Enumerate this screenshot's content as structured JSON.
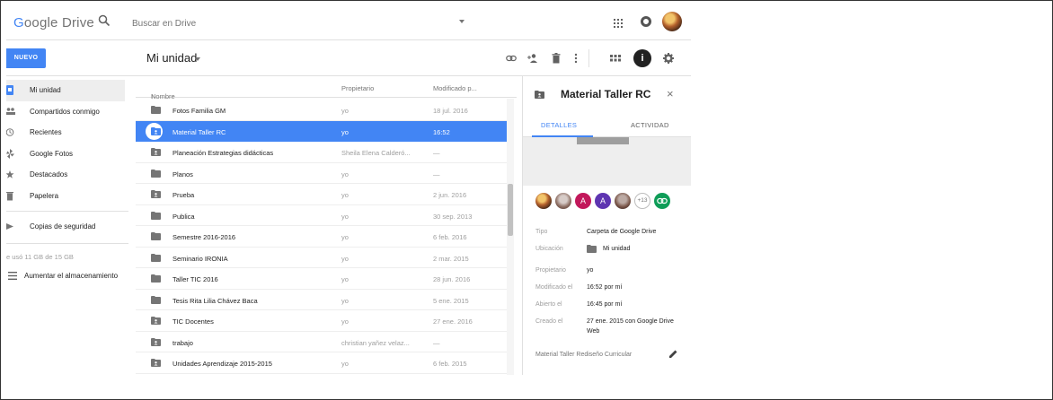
{
  "app": {
    "logo_text_1": "G",
    "logo_text_2": "oogle Drive",
    "search_placeholder": "Buscar en Drive"
  },
  "toolbar": {
    "new_button": "NUEVO",
    "breadcrumb": "Mi unidad"
  },
  "sidebar": {
    "items": [
      {
        "label": "Mi unidad",
        "icon": "drive-icon",
        "active": true
      },
      {
        "label": "Compartidos conmigo",
        "icon": "people-icon"
      },
      {
        "label": "Recientes",
        "icon": "clock-icon"
      },
      {
        "label": "Google Fotos",
        "icon": "pinwheel-icon"
      },
      {
        "label": "Destacados",
        "icon": "star-icon"
      },
      {
        "label": "Papelera",
        "icon": "trash-icon"
      },
      {
        "label": "Copias de seguridad",
        "icon": "backup-icon"
      }
    ],
    "storage_text": "e usó 11 GB de 15 GB",
    "upgrade_label": "Aumentar el almacenamiento"
  },
  "list": {
    "headers": {
      "name": "Nombre",
      "sort_arrow": "↑",
      "owner": "Propietario",
      "modified": "Modificado p..."
    },
    "rows": [
      {
        "name": "Fotos Familia GM",
        "owner": "yo",
        "modified": "18 jul. 2016",
        "shared": false
      },
      {
        "name": "Material Taller RC",
        "owner": "yo",
        "modified": "16:52",
        "shared": true,
        "selected": true
      },
      {
        "name": "Planeación Estrategias didácticas",
        "owner": "Sheila Elena Calderó...",
        "modified": "—",
        "shared": true
      },
      {
        "name": "Planos",
        "owner": "yo",
        "modified": "—",
        "shared": false
      },
      {
        "name": "Prueba",
        "owner": "yo",
        "modified": "2 jun. 2016",
        "shared": true
      },
      {
        "name": "Publica",
        "owner": "yo",
        "modified": "30 sep. 2013",
        "shared": false
      },
      {
        "name": "Semestre 2016-2016",
        "owner": "yo",
        "modified": "6 feb. 2016",
        "shared": false
      },
      {
        "name": "Seminario IRONIA",
        "owner": "yo",
        "modified": "2 mar. 2015",
        "shared": false
      },
      {
        "name": "Taller TIC 2016",
        "owner": "yo",
        "modified": "28 jun. 2016",
        "shared": false
      },
      {
        "name": "Tesis Rita Lilia Chávez Baca",
        "owner": "yo",
        "modified": "5 ene. 2015",
        "shared": false
      },
      {
        "name": "TIC Docentes",
        "owner": "yo",
        "modified": "27 ene. 2016",
        "shared": true
      },
      {
        "name": "trabajo",
        "owner": "christian yañez velaz...",
        "modified": "—",
        "shared": true
      },
      {
        "name": "Unidades Aprendizaje 2015-2015",
        "owner": "yo",
        "modified": "6 feb. 2015",
        "shared": true
      }
    ]
  },
  "details": {
    "title": "Material Taller RC",
    "close": "×",
    "tab_details": "DETALLES",
    "tab_activity": "ACTIVIDAD",
    "people": [
      {
        "type": "photo",
        "color": "#6d4c41"
      },
      {
        "type": "photo",
        "color": "#8d6e63"
      },
      {
        "type": "letter",
        "letter": "A",
        "color": "#c2185b"
      },
      {
        "type": "letter",
        "letter": "A",
        "color": "#5e35b1"
      },
      {
        "type": "photo",
        "color": "#795548"
      }
    ],
    "more_people": "+13",
    "props": {
      "tipo_k": "Tipo",
      "tipo_v": "Carpeta de Google Drive",
      "ubic_k": "Ubicación",
      "ubic_v": "Mi unidad",
      "prop_k": "Propietario",
      "prop_v": "yo",
      "mod_k": "Modificado el",
      "mod_v": "16:52 por mí",
      "abi_k": "Abierto el",
      "abi_v": "16:45 por mí",
      "cre_k": "Creado el",
      "cre_v1": "27 ene. 2015 con Google Drive",
      "cre_v2": "Web"
    },
    "description": "Material Taller Rediseño Curricular"
  },
  "colors": {
    "accent": "#4285f4",
    "link_green": "#0f9d58"
  }
}
